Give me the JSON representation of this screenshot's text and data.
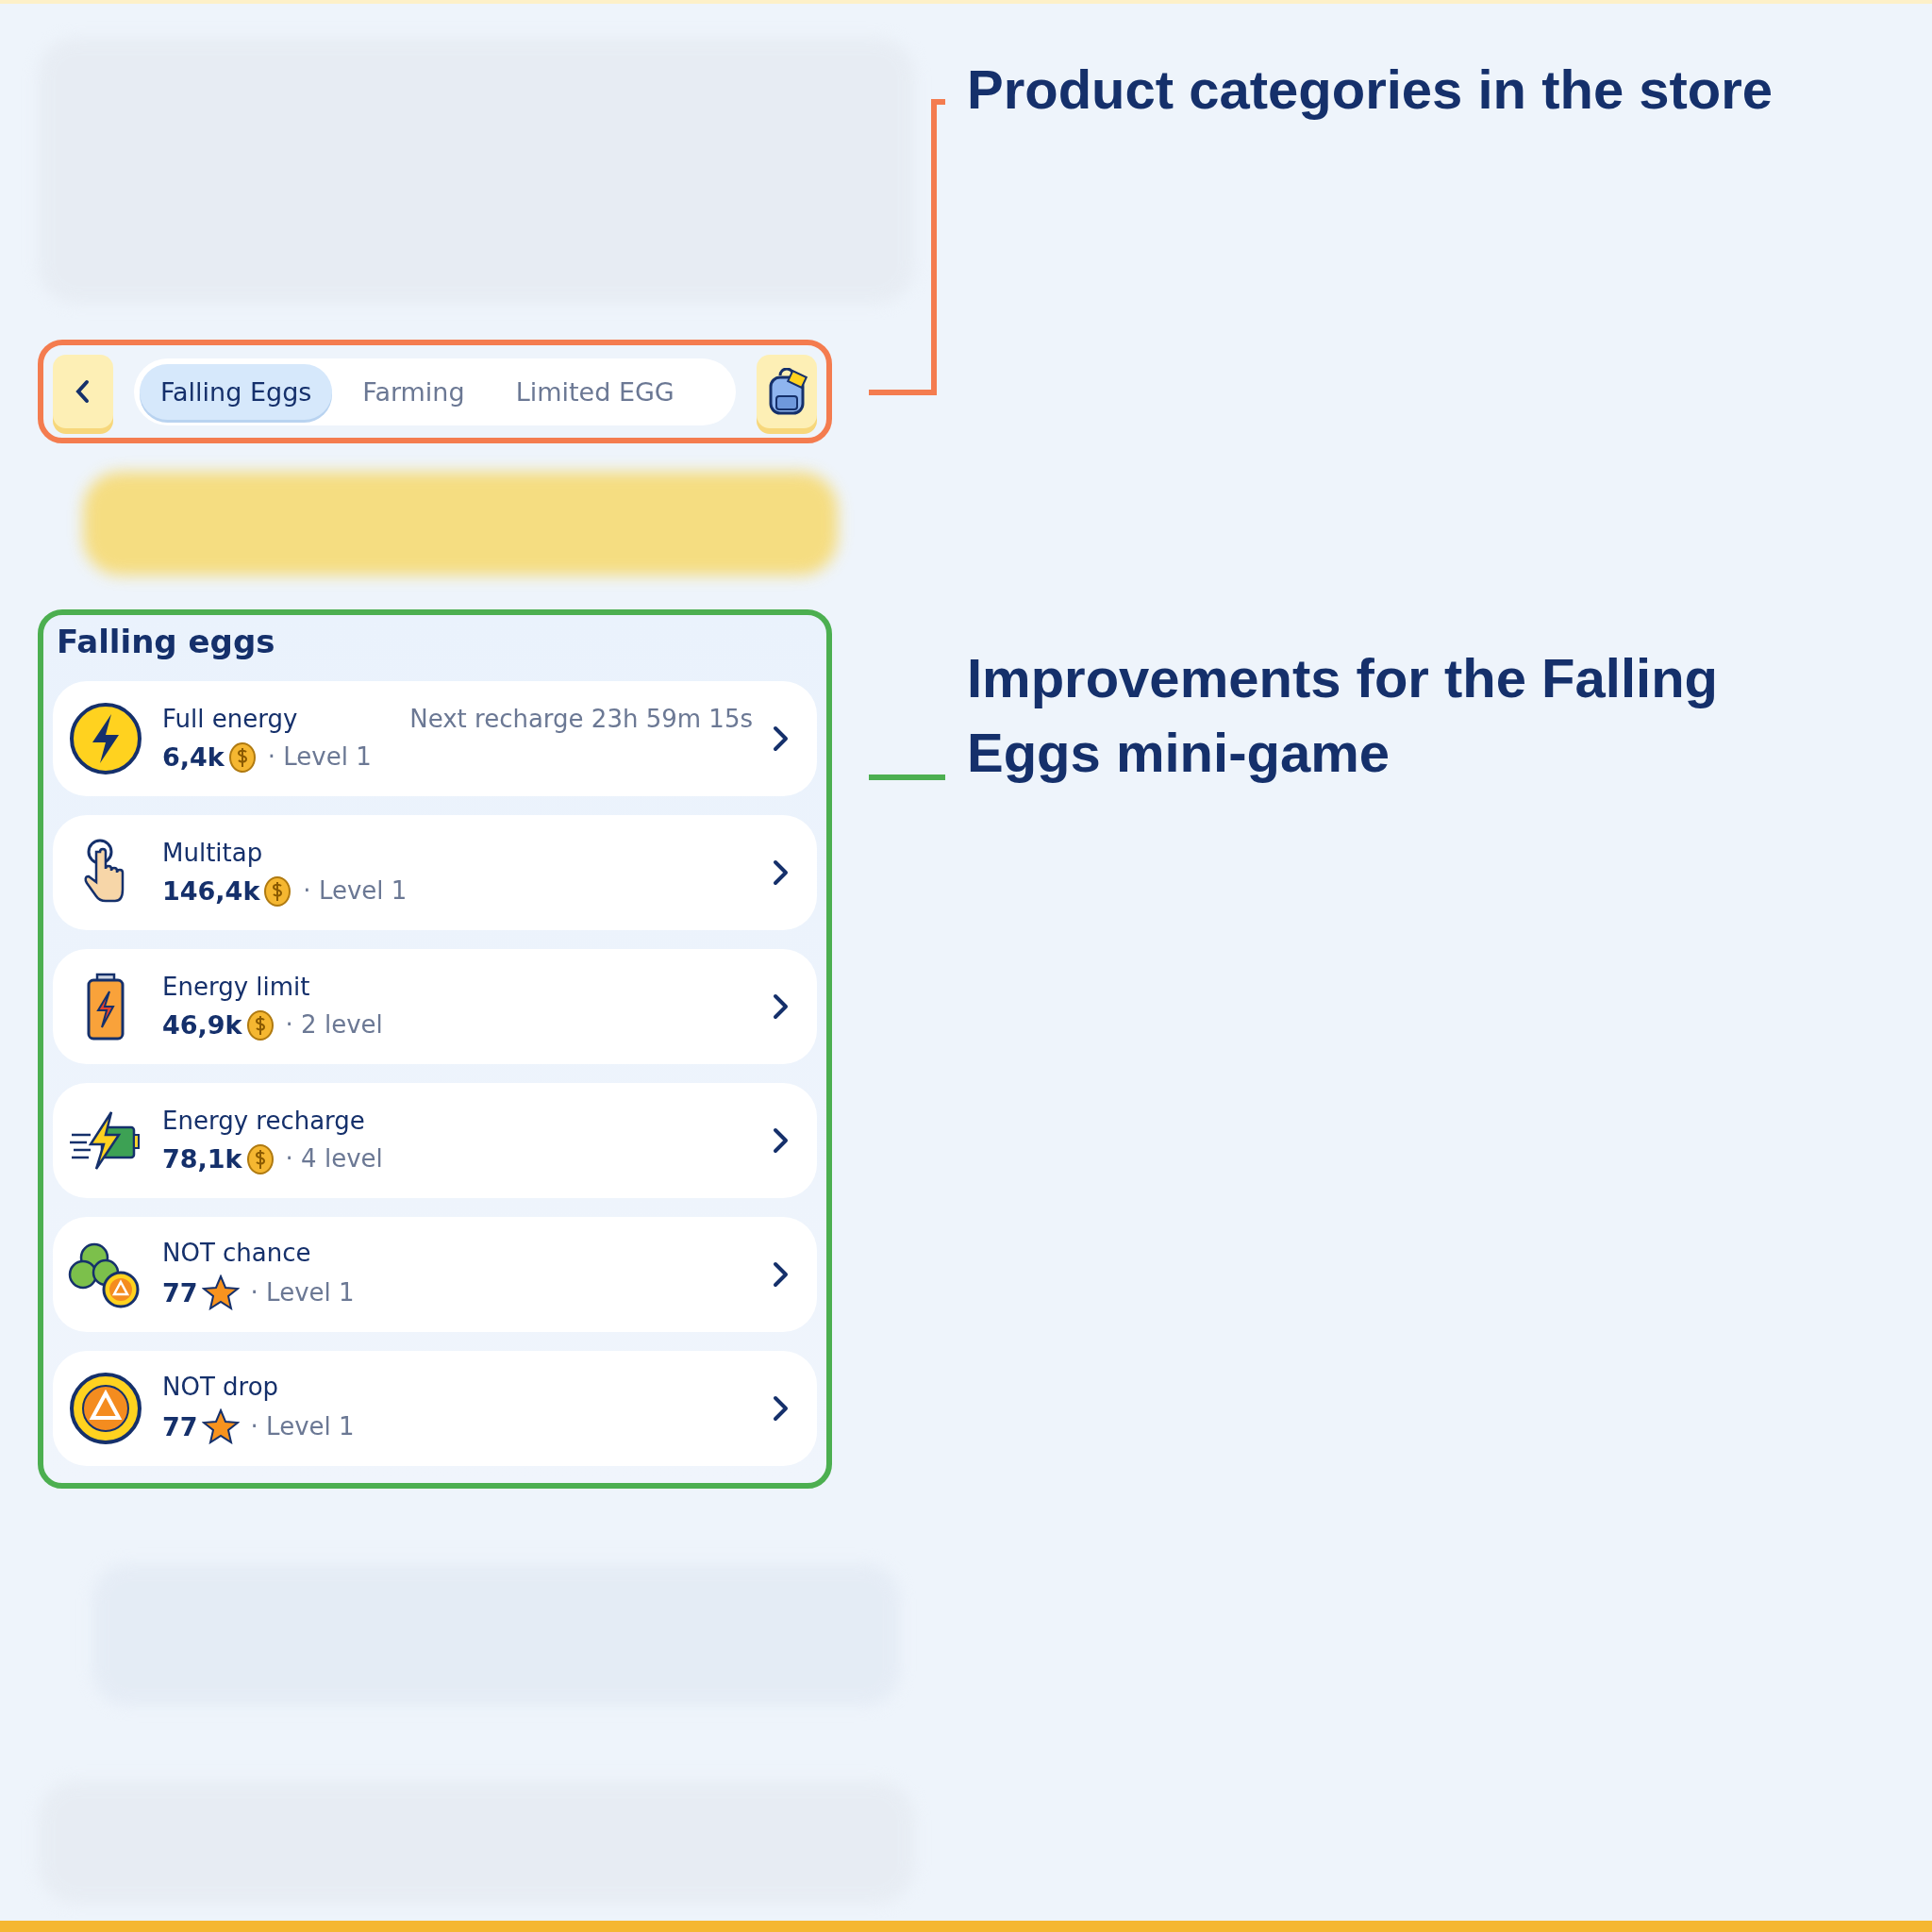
{
  "tabs_bar": {
    "tabs": [
      {
        "label": "Falling Eggs",
        "selected": true
      },
      {
        "label": "Farming",
        "selected": false
      },
      {
        "label": "Limited EGG",
        "selected": false
      }
    ]
  },
  "section": {
    "title": "Falling eggs",
    "items": [
      {
        "kind": "bolt",
        "name": "Full energy",
        "note": "Next recharge 23h 59m 15s",
        "price": "6,4k",
        "star_price": false,
        "level": "· Level 1"
      },
      {
        "kind": "hand",
        "name": "Multitap",
        "price": "146,4k",
        "star_price": false,
        "level": "· Level 1"
      },
      {
        "kind": "battery",
        "name": "Energy limit",
        "price": "46,9k",
        "star_price": false,
        "level": "· 2 level"
      },
      {
        "kind": "recharge",
        "name": "Energy recharge",
        "price": "78,1k",
        "star_price": false,
        "level": "· 4 level"
      },
      {
        "kind": "clover",
        "name": "NOT chance",
        "price": "77",
        "star_price": true,
        "level": "· Level 1"
      },
      {
        "kind": "token",
        "name": "NOT drop",
        "price": "77",
        "star_price": true,
        "level": "· Level 1"
      }
    ]
  },
  "annotations": [
    {
      "text": "Product categories in the store",
      "color": "#f47c4f"
    },
    {
      "text": "Improvements for the Falling Eggs mini-game",
      "color": "#4caf50"
    }
  ]
}
